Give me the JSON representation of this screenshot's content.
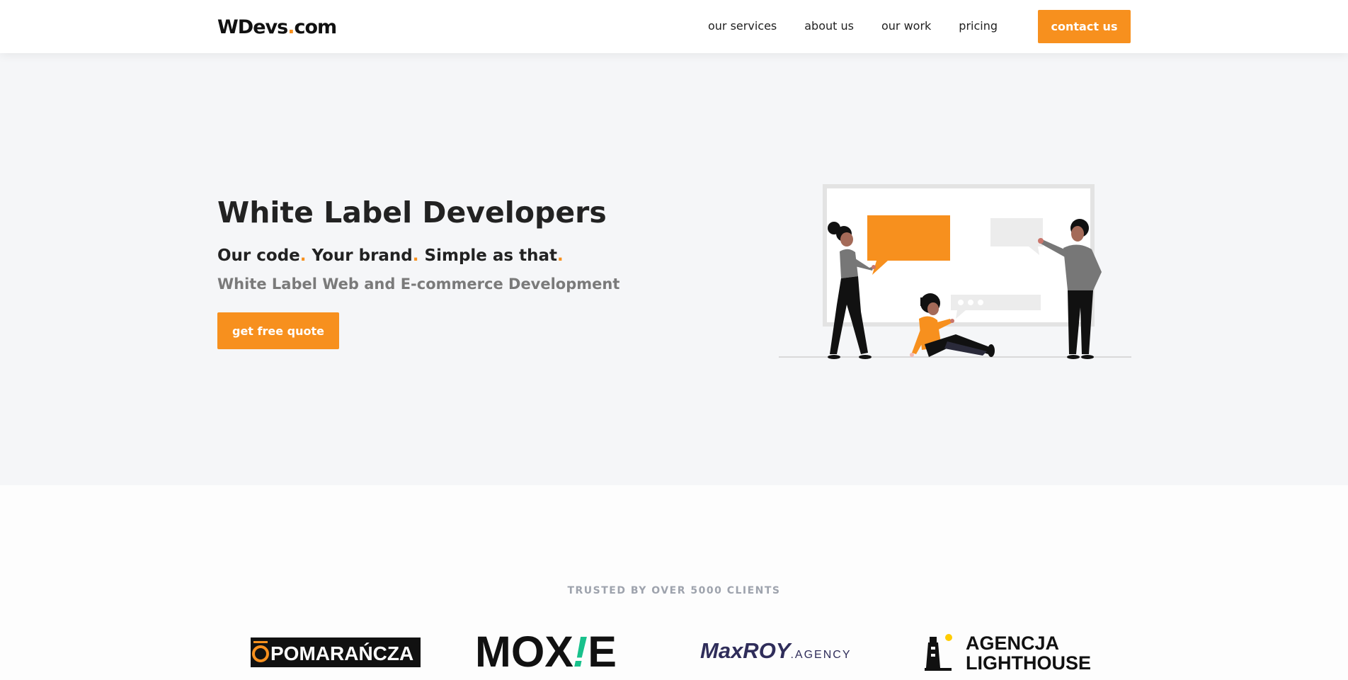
{
  "brand": {
    "logo_w": "W",
    "logo_rest": "Devs",
    "logo_dot": ".",
    "logo_tld": "com",
    "accent_color": "#f7901e"
  },
  "nav": {
    "links": [
      "our services",
      "about us",
      "our work",
      "pricing"
    ],
    "contact_label": "contact us"
  },
  "hero": {
    "title": "White Label Developers",
    "tagline": {
      "part1": "Our code",
      "part2": " Your brand",
      "part3": " Simple as that",
      "dot": "."
    },
    "description": "White Label Web and E-commerce Development",
    "cta_label": "get free quote"
  },
  "clients": {
    "heading": "TRUSTED BY OVER 5000 CLIENTS",
    "logos": [
      {
        "name": "pomarancza",
        "text": "POMARAŃCZA",
        "mark": "O"
      },
      {
        "name": "moxie",
        "text_left": "MOX",
        "text_right": "E",
        "mark": "!"
      },
      {
        "name": "maxroy",
        "text": "MaxROY",
        "suffix": ".AGENCY"
      },
      {
        "name": "agencja-lighthouse",
        "line1": "AGENCJA",
        "line2": "LIGHTHOUSE"
      }
    ]
  }
}
